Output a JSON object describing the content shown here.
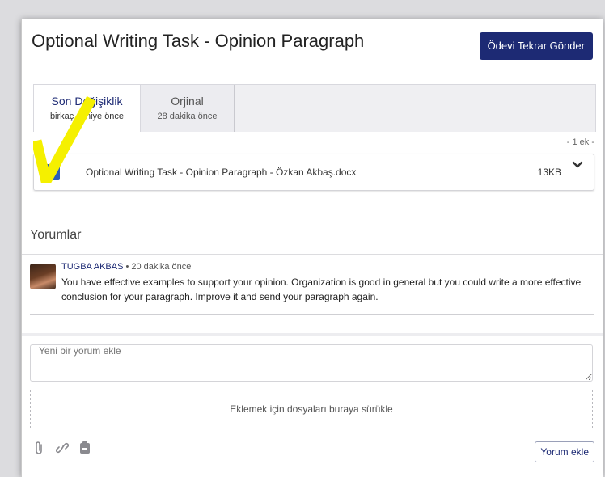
{
  "header": {
    "title": "Optional Writing Task - Opinion Paragraph",
    "resubmit_label": "Ödevi Tekrar Gönder"
  },
  "tabs": [
    {
      "label": "Son Değişiklik",
      "sub": "birkaç saniye önce",
      "active": true
    },
    {
      "label": "Orjinal",
      "sub": "28 dakika önce",
      "active": false
    }
  ],
  "attachments": {
    "count_label": "- 1 ek -",
    "file": {
      "icon": "word-icon",
      "icon_letter": "W",
      "name": "Optional Writing Task - Opinion Paragraph - Özkan Akbaş.docx",
      "size": "13KB"
    }
  },
  "comments": {
    "title": "Yorumlar",
    "items": [
      {
        "author": "TUGBA AKBAS",
        "time": "• 20 dakika önce",
        "text": "You have effective examples to support your opinion. Organization is good in general but you could write a more effective conclusion for your paragraph. Improve it and send your paragraph again."
      }
    ]
  },
  "composer": {
    "placeholder": "Yeni bir yorum ekle",
    "dropzone_label": "Eklemek için dosyaları buraya sürükle",
    "tools": [
      "paperclip-icon",
      "link-icon",
      "recorder-icon"
    ],
    "submit_label": "Yorum ekle"
  },
  "colors": {
    "accent": "#1d2a74",
    "highlight_mark": "#f5f000"
  }
}
